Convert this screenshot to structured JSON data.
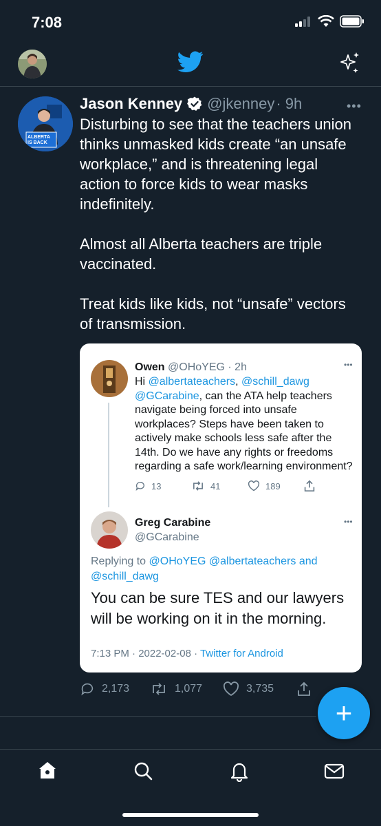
{
  "status_bar": {
    "time": "7:08"
  },
  "colors": {
    "background": "#15202b",
    "accent": "#1da1f2",
    "secondary_text": "#8899a6",
    "card": "#ffffff",
    "link": "#1b95e0"
  },
  "header": {
    "logo_icon": "twitter-bird-icon",
    "right_icon": "sparkle-icon"
  },
  "tweet": {
    "author_name": "Jason Kenney",
    "author_handle": "@jkenney",
    "time_ago": "· 9h",
    "more": "•••",
    "paragraphs": [
      "Disturbing to see that the teachers union thinks unmasked kids create “an unsafe workplace,” and is threatening legal action to force kids to wear masks indefinitely.",
      "Almost all Alberta teachers are triple vaccinated.",
      "Treat kids like kids, not “unsafe” vectors of transmission."
    ],
    "counts": {
      "replies": "2,173",
      "retweets": "1,077",
      "likes": "3,735"
    }
  },
  "quoted": {
    "reply_tweet": {
      "author_name": "Owen",
      "author_handle": "@OHoYEG",
      "time_ago": "· 2h",
      "text_hi": "Hi ",
      "mention1": "@albertateachers",
      "comma": ", ",
      "mention2": "@schill_dawg",
      "mention3": "@GCarabine",
      "text_rest": ", can the ATA help teachers navigate being forced into unsafe workplaces? Steps have been taken to actively make schools less safe after the 14th. Do we have any rights or freedoms regarding a safe work/learning environment?",
      "counts": {
        "replies": "13",
        "retweets": "41",
        "likes": "189"
      }
    },
    "main_tweet": {
      "author_name": "Greg Carabine",
      "author_handle": "@GCarabine",
      "replying_to_label": "Replying to ",
      "replying_to_links": "@OHoYEG @albertateachers and",
      "replying_to_links2": "@schill_dawg",
      "text": "You can be sure TES and our lawyers will be working on it in the morning.",
      "timestamp": "7:13 PM · 2022-02-08 · ",
      "source": "Twitter for Android"
    },
    "more": "•••"
  },
  "sign": {
    "line1": "ALBERTA",
    "line2": "IS BACK"
  },
  "fab": {
    "label": "+"
  },
  "tab_bar": {
    "icons": [
      "home-icon",
      "search-icon",
      "bell-icon",
      "mail-icon"
    ]
  }
}
